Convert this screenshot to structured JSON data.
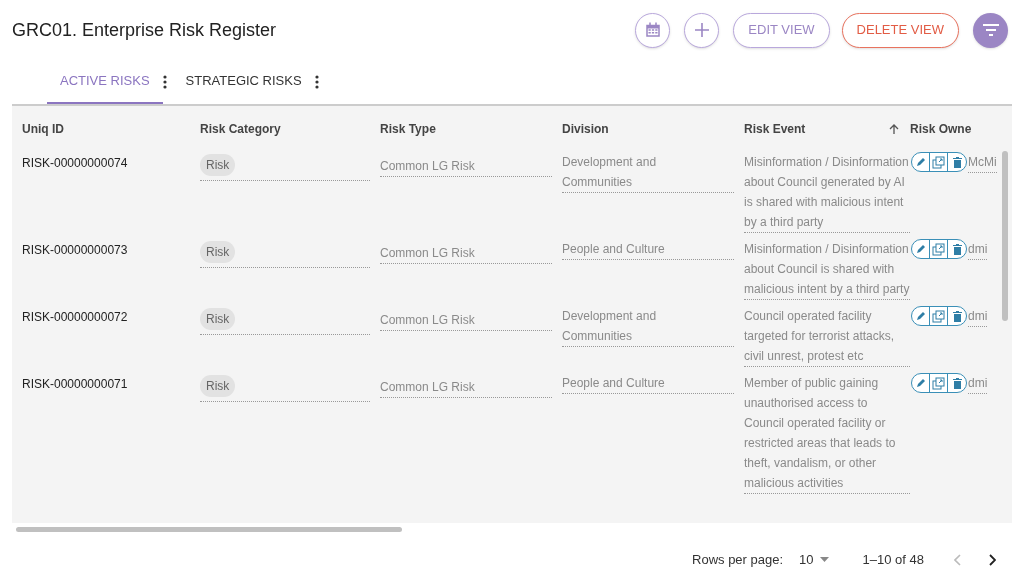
{
  "title": "GRC01. Enterprise Risk Register",
  "toolbar": [
    {
      "kind": "calendar"
    },
    {
      "kind": "add"
    },
    {
      "kind": "outline",
      "label": "EDIT VIEW"
    },
    {
      "kind": "danger",
      "label": "DELETE VIEW"
    },
    {
      "kind": "filter"
    }
  ],
  "tabs": [
    {
      "label": "ACTIVE RISKS",
      "selected": true
    },
    {
      "label": "STRATEGIC RISKS",
      "selected": false
    }
  ],
  "table": {
    "columns": [
      {
        "label": "Uniq ID"
      },
      {
        "label": "Risk Category"
      },
      {
        "label": "Risk Type"
      },
      {
        "label": "Division"
      },
      {
        "label": "Risk Event",
        "sorted": true
      },
      {
        "label": "Risk Owne"
      }
    ],
    "rows": [
      {
        "id": "RISK-00000000074",
        "category": "Risk",
        "type": "Common LG Risk",
        "division": "Development and Communities",
        "event": "Misinformation / Disinformation about Council generated by AI is shared with malicious intent by a third party",
        "owner": "McMi"
      },
      {
        "id": "RISK-00000000073",
        "category": "Risk",
        "type": "Common LG Risk",
        "division": "People and Culture",
        "event": "Misinformation / Disinformation about Council is shared with malicious intent by a third party",
        "owner": "dmi"
      },
      {
        "id": "RISK-00000000072",
        "category": "Risk",
        "type": "Common LG Risk",
        "division": "Development and Communities",
        "event": "Council operated facility targeted for terrorist attacks, civil unrest, protest etc",
        "owner": "dmi"
      },
      {
        "id": "RISK-00000000071",
        "category": "Risk",
        "type": "Common LG Risk",
        "division": "People and Culture",
        "event": "Member of public gaining unauthorised access to Council operated facility or restricted areas that leads to theft, vandalism, or other malicious activities",
        "owner": "dmi"
      }
    ]
  },
  "pagination": {
    "rows_per_page_label": "Rows per page:",
    "rows_per_page": "10",
    "range": "1–10 of 48"
  }
}
